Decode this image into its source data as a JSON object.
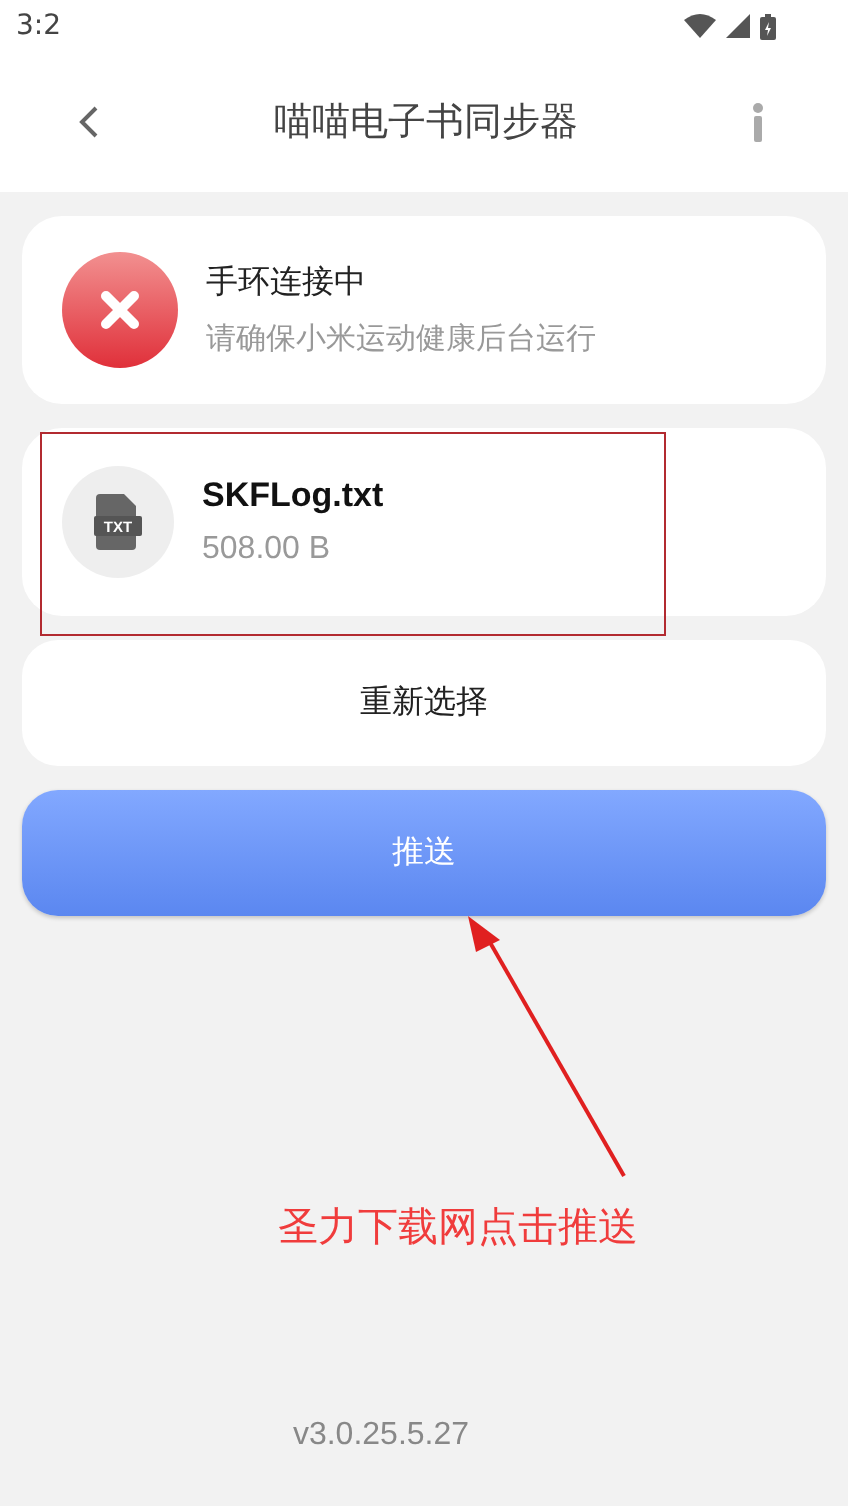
{
  "status_bar": {
    "time": "3:2"
  },
  "header": {
    "title": "喵喵电子书同步器"
  },
  "connection": {
    "connected": false,
    "title": "手环连接中",
    "subtitle": "请确保小米运动健康后台运行"
  },
  "file": {
    "icon_label": "TXT",
    "name": "SKFLog.txt",
    "size": "508.00 B"
  },
  "buttons": [
    {
      "kind": "secondary",
      "label": "重新选择"
    },
    {
      "kind": "primary",
      "label": "推送"
    }
  ],
  "annotation": {
    "text": "圣力下载网点击推送"
  },
  "version": "v3.0.25.5.27"
}
